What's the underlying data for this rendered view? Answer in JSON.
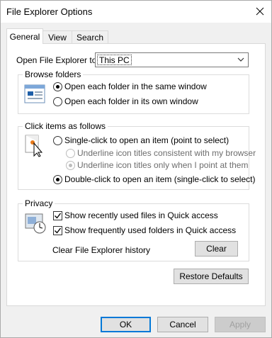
{
  "window": {
    "title": "File Explorer Options"
  },
  "tabs": [
    "General",
    "View",
    "Search"
  ],
  "open_in": {
    "label": "Open File Explorer to:",
    "value": "This PC"
  },
  "browse_folders": {
    "title": "Browse folders",
    "options": [
      "Open each folder in the same window",
      "Open each folder in its own window"
    ],
    "selected_index": 0
  },
  "click_items": {
    "title": "Click items as follows",
    "single_click": "Single-click to open an item (point to select)",
    "underline_consistent": "Underline icon titles consistent with my browser",
    "underline_point": "Underline icon titles only when I point at them",
    "double_click": "Double-click to open an item (single-click to select)",
    "selected": "double_click"
  },
  "privacy": {
    "title": "Privacy",
    "recent_files": "Show recently used files in Quick access",
    "frequent_folders": "Show frequently used folders in Quick access",
    "recent_files_checked": true,
    "frequent_folders_checked": true,
    "clear_history_label": "Clear File Explorer history",
    "clear_button": "Clear"
  },
  "restore_defaults": "Restore Defaults",
  "footer": {
    "ok": "OK",
    "cancel": "Cancel",
    "apply": "Apply"
  }
}
